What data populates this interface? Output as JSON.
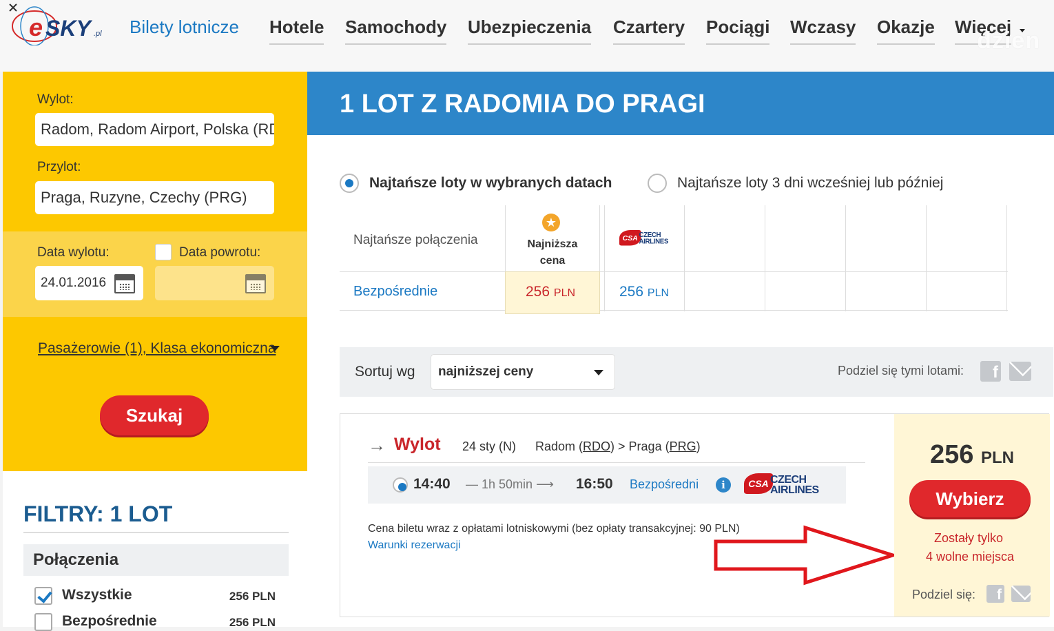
{
  "nav": {
    "logo_text": "eSKY.pl",
    "items": [
      "Bilety lotnicze",
      "Hotele",
      "Samochody",
      "Ubezpieczenia",
      "Czartery",
      "Pociągi",
      "Wczasy",
      "Okazje",
      "Więcej"
    ],
    "watermark": "dzien"
  },
  "search": {
    "wylot_label": "Wylot:",
    "wylot_value": "Radom, Radom Airport, Polska (RDO)",
    "przylot_label": "Przylot:",
    "przylot_value": "Praga, Ruzyne, Czechy (PRG)",
    "data_wylotu_label": "Data wylotu:",
    "data_wylotu_value": "24.01.2016",
    "data_powrotu_label": "Data powrotu:",
    "data_powrotu_value": "",
    "passengers": "Pasażerowie (1), Klasa ekonomiczna",
    "search_button": "Szukaj"
  },
  "filters": {
    "title": "FILTRY: 1 LOT",
    "section": "Połączenia",
    "rows": [
      {
        "label": "Wszystkie",
        "price": "256 PLN",
        "checked": true
      },
      {
        "label": "Bezpośrednie",
        "price": "256 PLN",
        "checked": false
      }
    ]
  },
  "main": {
    "title": "1 LOT Z RADOMIA DO PRAGI",
    "option_1": "Najtańsze loty w wybranych datach",
    "option_2": "Najtańsze loty 3 dni wcześniej lub później",
    "matrix": {
      "row_header": "Najtańsze połączenia",
      "lowest_header_1": "Najniższa",
      "lowest_header_2": "cena",
      "row_label": "Bezpośrednie",
      "lowest_price": "256",
      "airline_price": "256",
      "currency": "PLN"
    },
    "sort": {
      "label": "Sortuj wg",
      "value": "najniższej ceny",
      "share_label": "Podziel się tymi lotami:"
    },
    "result": {
      "direction": "Wylot",
      "date": "24 sty (N)",
      "from_city": "Radom",
      "from_code": "RDO",
      "to_city": "Praga",
      "to_code": "PRG",
      "departure": "14:40",
      "duration": "1h 50min",
      "arrival": "16:50",
      "stops": "Bezpośredni",
      "airline_name_1": "CZECH",
      "airline_name_2": "AIRLINES",
      "airline_code": "CSA",
      "price_note": "Cena biletu wraz z opłatami lotniskowymi (bez opłaty transakcyjnej: 90 PLN)",
      "terms_link": "Warunki rezerwacji",
      "price": "256",
      "currency": "PLN",
      "select_button": "Wybierz",
      "seats_1": "Zostały tylko",
      "seats_2": "4 wolne miejsca",
      "share_label": "Podziel się:"
    }
  },
  "colors": {
    "brand_blue": "#2d86c9",
    "accent_red": "#e0282c",
    "panel_yellow": "#fdc800",
    "highlight_cream": "#fff6d6"
  }
}
